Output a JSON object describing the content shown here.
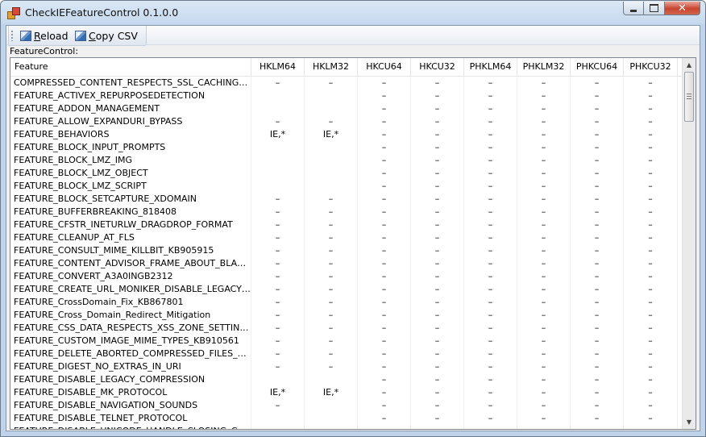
{
  "window": {
    "title": "CheckIEFeatureControl 0.1.0.0"
  },
  "toolbar": {
    "reload_label": "Reload",
    "reload_mnemonic": "R",
    "reload_rest": "eload",
    "copy_label": "Copy CSV",
    "copy_mnemonic": "C",
    "copy_rest": "opy CSV"
  },
  "feature_control_label": "FeatureControl:",
  "grid": {
    "columns": [
      "Feature",
      "HKLM64",
      "HKLM32",
      "HKCU64",
      "HKCU32",
      "PHKLM64",
      "PHKLM32",
      "PHKCU64",
      "PHKCU32"
    ],
    "rows": [
      [
        "COMPRESSED_CONTENT_RESPECTS_SSL_CACHING_S...",
        "–",
        "–",
        "–",
        "–",
        "–",
        "–",
        "–",
        "–"
      ],
      [
        "FEATURE_ACTIVEX_REPURPOSEDETECTION",
        "",
        "",
        "–",
        "–",
        "–",
        "–",
        "–",
        "–"
      ],
      [
        "FEATURE_ADDON_MANAGEMENT",
        "",
        "",
        "–",
        "–",
        "–",
        "–",
        "–",
        "–"
      ],
      [
        "FEATURE_ALLOW_EXPANDURI_BYPASS",
        "–",
        "–",
        "–",
        "–",
        "–",
        "–",
        "–",
        "–"
      ],
      [
        "FEATURE_BEHAVIORS",
        "IE,*",
        "IE,*",
        "–",
        "–",
        "–",
        "–",
        "–",
        "–"
      ],
      [
        "FEATURE_BLOCK_INPUT_PROMPTS",
        "",
        "",
        "–",
        "–",
        "–",
        "–",
        "–",
        "–"
      ],
      [
        "FEATURE_BLOCK_LMZ_IMG",
        "",
        "",
        "–",
        "–",
        "–",
        "–",
        "–",
        "–"
      ],
      [
        "FEATURE_BLOCK_LMZ_OBJECT",
        "",
        "",
        "–",
        "–",
        "–",
        "–",
        "–",
        "–"
      ],
      [
        "FEATURE_BLOCK_LMZ_SCRIPT",
        "",
        "",
        "–",
        "–",
        "–",
        "–",
        "–",
        "–"
      ],
      [
        "FEATURE_BLOCK_SETCAPTURE_XDOMAIN",
        "–",
        "–",
        "–",
        "–",
        "–",
        "–",
        "–",
        "–"
      ],
      [
        "FEATURE_BUFFERBREAKING_818408",
        "–",
        "–",
        "–",
        "–",
        "–",
        "–",
        "–",
        "–"
      ],
      [
        "FEATURE_CFSTR_INETURLW_DRAGDROP_FORMAT",
        "–",
        "–",
        "–",
        "–",
        "–",
        "–",
        "–",
        "–"
      ],
      [
        "FEATURE_CLEANUP_AT_FLS",
        "–",
        "–",
        "–",
        "–",
        "–",
        "–",
        "–",
        "–"
      ],
      [
        "FEATURE_CONSULT_MIME_KILLBIT_KB905915",
        "–",
        "–",
        "–",
        "–",
        "–",
        "–",
        "–",
        "–"
      ],
      [
        "FEATURE_CONTENT_ADVISOR_FRAME_ABOUT_BLAN...",
        "–",
        "–",
        "–",
        "–",
        "–",
        "–",
        "–",
        "–"
      ],
      [
        "FEATURE_CONVERT_A3A0INGB2312",
        "–",
        "–",
        "–",
        "–",
        "–",
        "–",
        "–",
        "–"
      ],
      [
        "FEATURE_CREATE_URL_MONIKER_DISABLE_LEGACY_...",
        "–",
        "–",
        "–",
        "–",
        "–",
        "–",
        "–",
        "–"
      ],
      [
        "FEATURE_CrossDomain_Fix_KB867801",
        "–",
        "–",
        "–",
        "–",
        "–",
        "–",
        "–",
        "–"
      ],
      [
        "FEATURE_Cross_Domain_Redirect_Mitigation",
        "–",
        "–",
        "–",
        "–",
        "–",
        "–",
        "–",
        "–"
      ],
      [
        "FEATURE_CSS_DATA_RESPECTS_XSS_ZONE_SETTING...",
        "–",
        "–",
        "–",
        "–",
        "–",
        "–",
        "–",
        "–"
      ],
      [
        "FEATURE_CUSTOM_IMAGE_MIME_TYPES_KB910561",
        "–",
        "–",
        "–",
        "–",
        "–",
        "–",
        "–",
        "–"
      ],
      [
        "FEATURE_DELETE_ABORTED_COMPRESSED_FILES_K...",
        "–",
        "–",
        "–",
        "–",
        "–",
        "–",
        "–",
        "–"
      ],
      [
        "FEATURE_DIGEST_NO_EXTRAS_IN_URI",
        "–",
        "–",
        "–",
        "–",
        "–",
        "–",
        "–",
        "–"
      ],
      [
        "FEATURE_DISABLE_LEGACY_COMPRESSION",
        "",
        "",
        "–",
        "–",
        "–",
        "–",
        "–",
        "–"
      ],
      [
        "FEATURE_DISABLE_MK_PROTOCOL",
        "IE,*",
        "IE,*",
        "–",
        "–",
        "–",
        "–",
        "–",
        "–"
      ],
      [
        "FEATURE_DISABLE_NAVIGATION_SOUNDS",
        "–",
        "",
        "–",
        "–",
        "–",
        "–",
        "–",
        "–"
      ],
      [
        "FEATURE_DISABLE_TELNET_PROTOCOL",
        "",
        "",
        "–",
        "–",
        "–",
        "–",
        "–",
        "–"
      ],
      [
        "FEATURE_DISABLE_UNICODE_HANDLE_CLOSING_CAL...",
        "–",
        "–",
        "–",
        "–",
        "–",
        "–",
        "–",
        "–"
      ]
    ]
  },
  "scrollbar": {
    "up_glyph": "▲",
    "down_glyph": "▼"
  },
  "icons": [
    "app-icon",
    "reload-icon",
    "copy-csv-icon",
    "minimize-icon",
    "maximize-icon",
    "close-icon",
    "scroll-up-icon",
    "scroll-down-icon"
  ],
  "colors": {
    "title_bar": "#c6d9ee",
    "close_button": "#c9452f",
    "grid_border": "#828790"
  }
}
